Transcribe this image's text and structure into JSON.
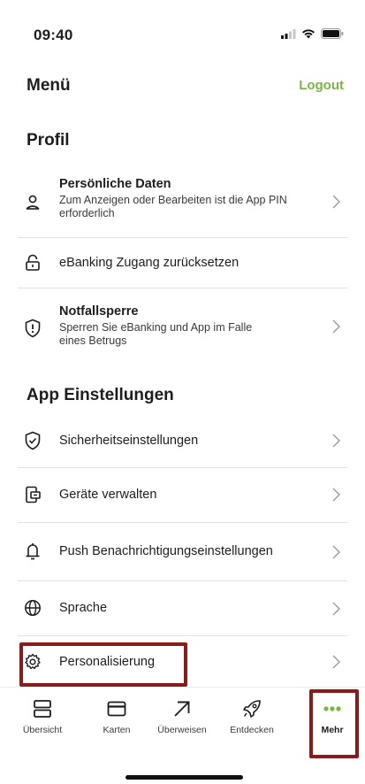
{
  "status_bar": {
    "time": "09:40"
  },
  "header": {
    "title": "Menü",
    "logout_label": "Logout"
  },
  "colors": {
    "accent": "#7cb342",
    "highlight": "#8b1a1a"
  },
  "sections": {
    "profil": {
      "title": "Profil",
      "items": [
        {
          "title": "Persönliche Daten",
          "subtitle": "Zum Anzeigen oder Bearbeiten ist die App PIN erforderlich",
          "icon": "person-icon"
        },
        {
          "label": "eBanking Zugang zurücksetzen",
          "icon": "unlock-icon"
        },
        {
          "title": "Notfallsperre",
          "subtitle": "Sperren Sie eBanking und App im Falle eines Betrugs",
          "icon": "shield-alert-icon"
        }
      ]
    },
    "app": {
      "title": "App Einstellungen",
      "items": [
        {
          "label": "Sicherheitseinstellungen",
          "icon": "shield-check-icon"
        },
        {
          "label": "Geräte verwalten",
          "icon": "devices-icon"
        },
        {
          "label": "Push Benachrichtigungseinstellungen",
          "icon": "bell-icon"
        },
        {
          "label": "Sprache",
          "icon": "globe-icon"
        },
        {
          "label": "Personalisierung",
          "icon": "gear-icon"
        }
      ]
    }
  },
  "tabbar": {
    "tabs": [
      {
        "label": "Übersicht",
        "icon": "overview-icon"
      },
      {
        "label": "Karten",
        "icon": "card-icon"
      },
      {
        "label": "Überweisen",
        "icon": "arrow-up-right-icon"
      },
      {
        "label": "Entdecken",
        "icon": "rocket-icon"
      },
      {
        "label": "Mehr",
        "icon": "more-dots-icon",
        "active": true
      }
    ]
  }
}
